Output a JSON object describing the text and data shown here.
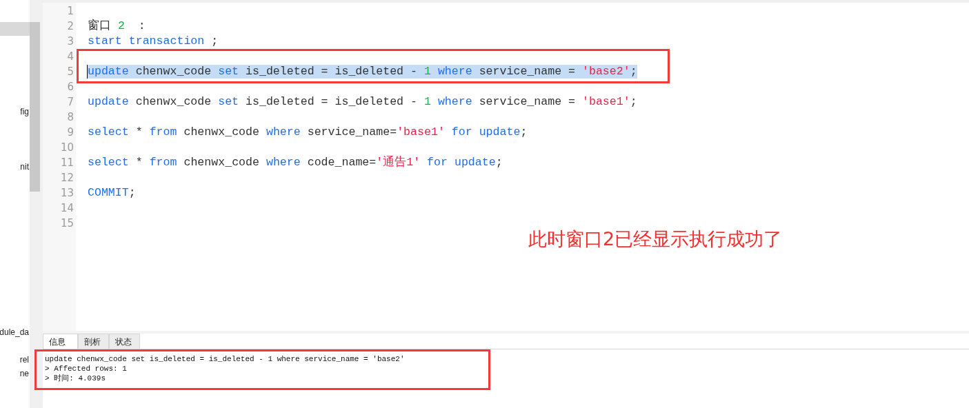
{
  "sidebar": {
    "items": [
      {
        "label": "fig"
      },
      {
        "label": "nit"
      },
      {
        "label": "dule_da"
      },
      {
        "label": "rel"
      },
      {
        "label": "ne"
      }
    ]
  },
  "editor": {
    "lines": [
      {
        "number": "1",
        "selected": false
      },
      {
        "number": "2",
        "selected": false,
        "tokens": [
          {
            "kind": "plain",
            "text": "窗口 "
          },
          {
            "kind": "number",
            "text": "2"
          },
          {
            "kind": "plain",
            "text": "  :"
          }
        ]
      },
      {
        "number": "3",
        "selected": false,
        "tokens": [
          {
            "kind": "keyword",
            "text": "start transaction"
          },
          {
            "kind": "plain",
            "text": " ;"
          }
        ]
      },
      {
        "number": "4",
        "selected": false
      },
      {
        "number": "5",
        "selected": true,
        "annotated": true,
        "tokens": [
          {
            "kind": "keyword",
            "text": "update"
          },
          {
            "kind": "plain",
            "text": " chenwx_code "
          },
          {
            "kind": "keyword",
            "text": "set"
          },
          {
            "kind": "plain",
            "text": " is_deleted = is_deleted - "
          },
          {
            "kind": "number",
            "text": "1"
          },
          {
            "kind": "keyword",
            "text": " where"
          },
          {
            "kind": "plain",
            "text": " service_name = "
          },
          {
            "kind": "string",
            "text": "'base2'"
          },
          {
            "kind": "plain",
            "text": ";"
          }
        ]
      },
      {
        "number": "6",
        "selected": false
      },
      {
        "number": "7",
        "selected": false,
        "tokens": [
          {
            "kind": "keyword",
            "text": "update"
          },
          {
            "kind": "plain",
            "text": " chenwx_code "
          },
          {
            "kind": "keyword",
            "text": "set"
          },
          {
            "kind": "plain",
            "text": " is_deleted = is_deleted - "
          },
          {
            "kind": "number",
            "text": "1"
          },
          {
            "kind": "keyword",
            "text": " where"
          },
          {
            "kind": "plain",
            "text": " service_name = "
          },
          {
            "kind": "string",
            "text": "'base1'"
          },
          {
            "kind": "plain",
            "text": ";"
          }
        ]
      },
      {
        "number": "8",
        "selected": false
      },
      {
        "number": "9",
        "selected": false,
        "tokens": [
          {
            "kind": "keyword",
            "text": "select"
          },
          {
            "kind": "plain",
            "text": " * "
          },
          {
            "kind": "keyword",
            "text": "from"
          },
          {
            "kind": "plain",
            "text": " chenwx_code "
          },
          {
            "kind": "keyword",
            "text": "where"
          },
          {
            "kind": "plain",
            "text": " service_name="
          },
          {
            "kind": "string",
            "text": "'base1'"
          },
          {
            "kind": "keyword",
            "text": " for update"
          },
          {
            "kind": "plain",
            "text": ";"
          }
        ]
      },
      {
        "number": "10",
        "selected": false
      },
      {
        "number": "11",
        "selected": false,
        "tokens": [
          {
            "kind": "keyword",
            "text": "select"
          },
          {
            "kind": "plain",
            "text": " * "
          },
          {
            "kind": "keyword",
            "text": "from"
          },
          {
            "kind": "plain",
            "text": " chenwx_code "
          },
          {
            "kind": "keyword",
            "text": "where"
          },
          {
            "kind": "plain",
            "text": " code_name="
          },
          {
            "kind": "string",
            "text": "'通告1'"
          },
          {
            "kind": "keyword",
            "text": " for update"
          },
          {
            "kind": "plain",
            "text": ";"
          }
        ]
      },
      {
        "number": "12",
        "selected": false
      },
      {
        "number": "13",
        "selected": false,
        "tokens": [
          {
            "kind": "keyword",
            "text": "COMMIT"
          },
          {
            "kind": "plain",
            "text": ";"
          }
        ]
      },
      {
        "number": "14",
        "selected": false
      },
      {
        "number": "15",
        "selected": false
      }
    ],
    "annotation": "此时窗口2已经显示执行成功了"
  },
  "result_panel": {
    "tabs": [
      {
        "label": "信息",
        "selected": true
      },
      {
        "label": "剖析",
        "selected": false
      },
      {
        "label": "状态",
        "selected": false
      }
    ],
    "output_lines": [
      "update chenwx_code set is_deleted = is_deleted - 1 where service_name = 'base2'",
      "> Affected rows: 1",
      "> 时间: 4.039s"
    ],
    "annotated": true
  }
}
